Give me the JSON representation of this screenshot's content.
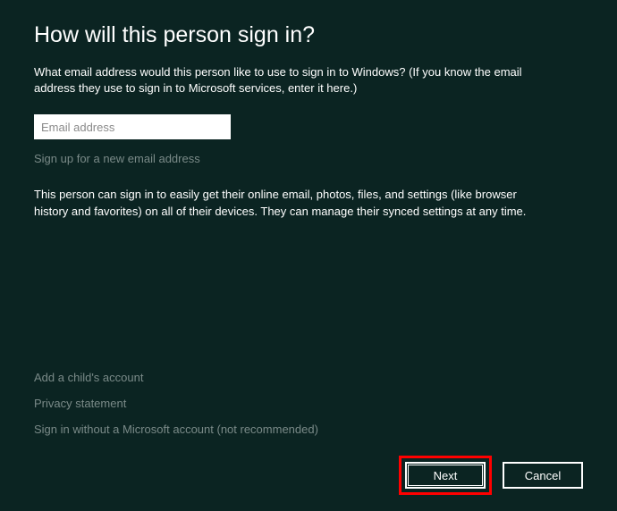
{
  "header": {
    "title": "How will this person sign in?"
  },
  "main": {
    "prompt": "What email address would this person like to use to sign in to Windows? (If you know the email address they use to sign in to Microsoft services, enter it here.)",
    "email_placeholder": "Email address",
    "email_value": "",
    "signup_link": "Sign up for a new email address",
    "info_text": "This person can sign in to easily get their online email, photos, files, and settings (like browser history and favorites) on all of their devices. They can manage their synced settings at any time."
  },
  "bottom_links": {
    "child_account": "Add a child's account",
    "privacy": "Privacy statement",
    "no_ms_account": "Sign in without a Microsoft account (not recommended)"
  },
  "buttons": {
    "next_label": "Next",
    "cancel_label": "Cancel"
  }
}
